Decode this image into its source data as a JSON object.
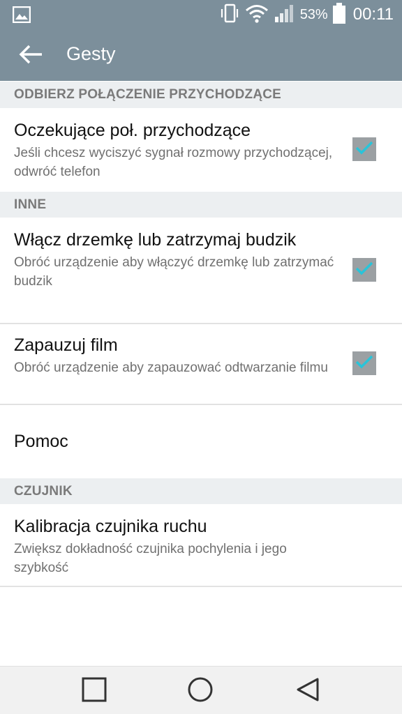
{
  "status_bar": {
    "battery_percent": "53%",
    "time": "00:11",
    "icons": [
      "gallery-icon",
      "vibrate-icon",
      "wifi-icon",
      "signal-icon",
      "battery-icon"
    ]
  },
  "app_bar": {
    "title": "Gesty",
    "back_icon": "back-arrow-icon"
  },
  "sections": [
    {
      "header": "ODBIERZ POŁĄCZENIE PRZYCHODZĄCE",
      "items": [
        {
          "title": "Oczekujące poł. przychodzące",
          "subtitle": "Jeśli chcesz wyciszyć sygnał rozmowy przychodzącej, odwróć telefon",
          "checked": true
        }
      ]
    },
    {
      "header": "INNE",
      "items": [
        {
          "title": "Włącz drzemkę lub zatrzymaj budzik",
          "subtitle": "Obróć urządzenie aby włączyć drzemkę lub zatrzymać budzik",
          "checked": true
        },
        {
          "title": "Zapauzuj film",
          "subtitle": "Obróć urządzenie aby zapauzować odtwarzanie filmu",
          "checked": true
        },
        {
          "title": "Pomoc"
        }
      ]
    },
    {
      "header": "CZUJNIK",
      "items": [
        {
          "title": "Kalibracja czujnika ruchu",
          "subtitle": "Zwiększ dokładność czujnika pochylenia i jego szybkość"
        }
      ]
    }
  ],
  "colors": {
    "bar": "#7c8f9b",
    "section_bg": "#eceff1",
    "check_accent": "#29c4d9",
    "checkbox_bg": "#9ba0a3"
  },
  "nav_bar": {
    "icons": [
      "recents-square-icon",
      "home-circle-icon",
      "back-triangle-icon"
    ]
  }
}
